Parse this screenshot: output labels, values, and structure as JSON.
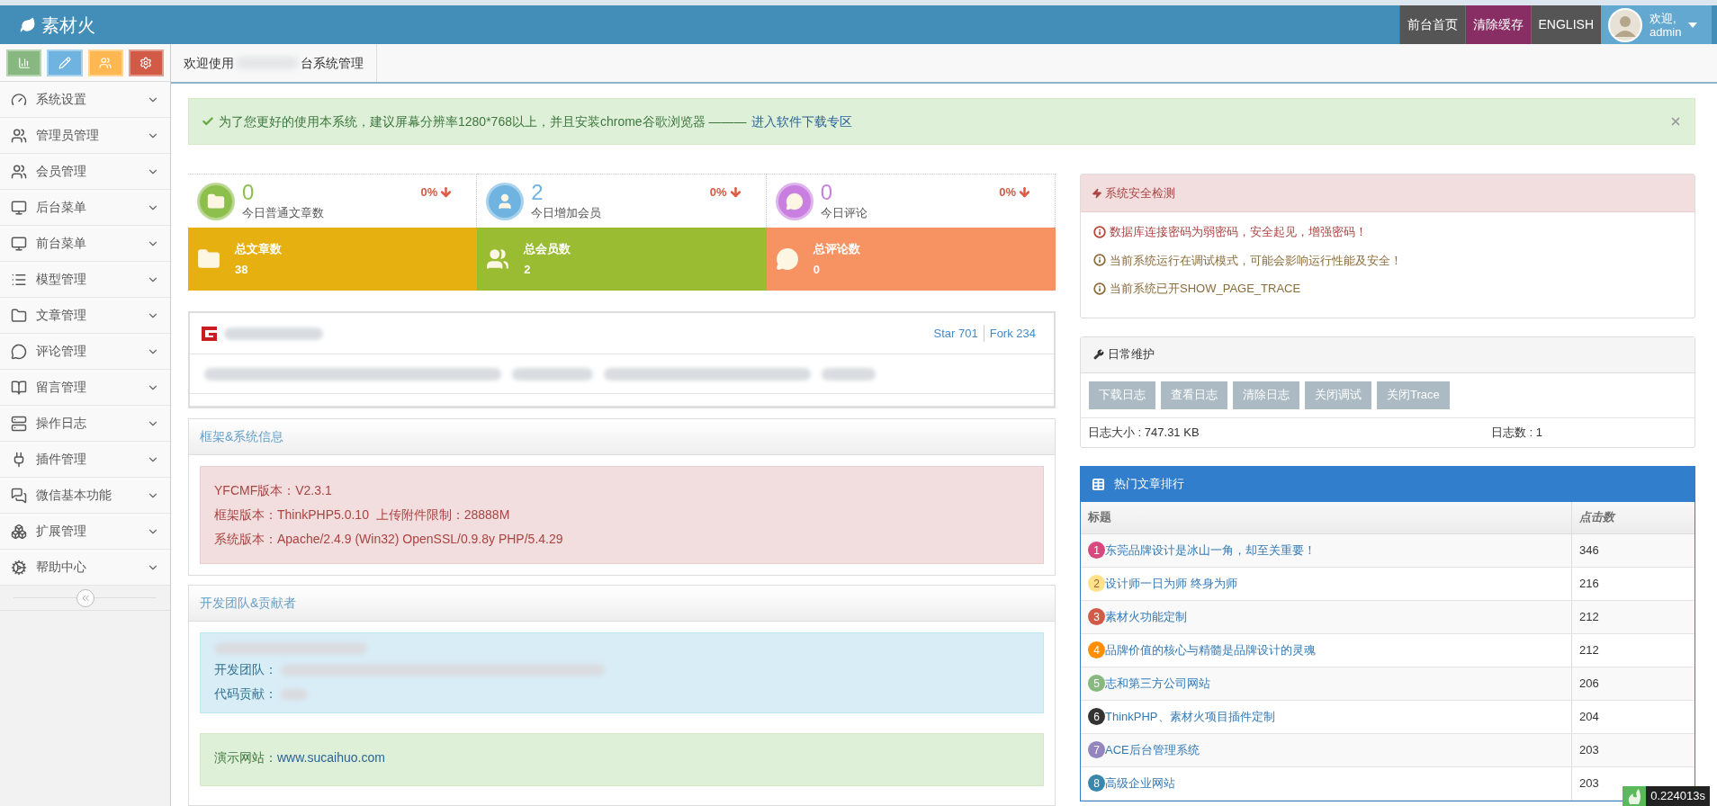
{
  "header": {
    "brand": "素材火",
    "nav_buttons": [
      {
        "label": "前台首页",
        "color": "#555555"
      },
      {
        "label": "清除缓存",
        "color": "#892e65"
      },
      {
        "label": "ENGLISH",
        "color": "#555555"
      }
    ],
    "user": {
      "greeting": "欢迎,",
      "name": "admin"
    }
  },
  "shortcuts": [
    {
      "kind": "chart",
      "color": "#87b87f"
    },
    {
      "kind": "pencil",
      "color": "#6fb3e0"
    },
    {
      "kind": "users",
      "color": "#ffb752"
    },
    {
      "kind": "cogs",
      "color": "#d15b47"
    }
  ],
  "sidebar": {
    "items": [
      {
        "label": "系统设置"
      },
      {
        "label": "管理员管理"
      },
      {
        "label": "会员管理"
      },
      {
        "label": "后台菜单"
      },
      {
        "label": "前台菜单"
      },
      {
        "label": "模型管理"
      },
      {
        "label": "文章管理"
      },
      {
        "label": "评论管理"
      },
      {
        "label": "留言管理"
      },
      {
        "label": "操作日志"
      },
      {
        "label": "插件管理"
      },
      {
        "label": "微信基本功能"
      },
      {
        "label": "扩展管理"
      },
      {
        "label": "帮助中心"
      }
    ]
  },
  "tabs": [
    {
      "label_parts": [
        "欢迎使用",
        "台系统管理"
      ],
      "selected": true
    }
  ],
  "alert": {
    "text": "为了您更好的使用本系统，建议屏幕分辨率1280*768以上，并且安装chrome谷歌浏览器 ———",
    "link": "进入软件下载专区"
  },
  "stats": [
    {
      "today": {
        "count": "0",
        "label": "今日普通文章数",
        "change": "0%",
        "color": "#8cbf4c"
      },
      "total": {
        "label": "总文章数",
        "value": "38",
        "color": "#e7b011"
      }
    },
    {
      "today": {
        "count": "2",
        "label": "今日增加会员",
        "change": "0%",
        "color": "#6fb3e0"
      },
      "total": {
        "label": "总会员数",
        "value": "2",
        "color": "#9abc32"
      }
    },
    {
      "today": {
        "count": "0",
        "label": "今日评论",
        "change": "0%",
        "color": "#c97fe0"
      },
      "total": {
        "label": "总评论数",
        "value": "0",
        "color": "#f79263"
      }
    }
  ],
  "git_panel": {
    "links": [
      "Star 701",
      "Fork 234"
    ]
  },
  "system_info": {
    "title": "框架&系统信息",
    "lines": [
      "YFCMF版本：V2.3.1",
      "框架版本：ThinkPHP5.0.10  上传附件限制：28888M",
      "系统版本：Apache/2.4.9 (Win32) OpenSSL/0.9.8y PHP/5.4.29"
    ]
  },
  "team": {
    "title": "开发团队&贡献者",
    "info_lines": [
      "开发团队：",
      "代码贡献："
    ],
    "demo": {
      "label": "演示网站：",
      "link": "www.sucaihuo.com"
    }
  },
  "security": {
    "title": "系统安全检测",
    "items": [
      {
        "kind": "danger",
        "text": "数据库连接密码为弱密码，安全起见，增强密码！"
      },
      {
        "kind": "warning",
        "text": "当前系统运行在调试模式，可能会影响运行性能及安全！"
      },
      {
        "kind": "warning",
        "text": "当前系统已开SHOW_PAGE_TRACE"
      }
    ]
  },
  "maintenance": {
    "title": "日常维护",
    "buttons": [
      "下载日志",
      "查看日志",
      "清除日志",
      "关闭调试",
      "关闭Trace"
    ],
    "log_size": "日志大小 : 747.31 KB",
    "log_count": "日志数 : 1"
  },
  "hot_articles": {
    "title": "热门文章排行",
    "columns": [
      "标题",
      "点击数"
    ],
    "rows": [
      {
        "rank": "1",
        "title": "东莞品牌设计是冰山一角，却至关重要！",
        "clicks": "346",
        "color": "#d6487e"
      },
      {
        "rank": "2",
        "title": "设计师一日为师 终身为师",
        "clicks": "216",
        "color": "#fee188"
      },
      {
        "rank": "3",
        "title": "素材火功能定制",
        "clicks": "212",
        "color": "#d15b47"
      },
      {
        "rank": "4",
        "title": "品牌价值的核心与精髓是品牌设计的灵魂",
        "clicks": "212",
        "color": "#ff8f00"
      },
      {
        "rank": "5",
        "title": "志和第三方公司网站",
        "clicks": "206",
        "color": "#87b87f"
      },
      {
        "rank": "6",
        "title": "ThinkPHP、素材火项目插件定制",
        "clicks": "204",
        "color": "#333333"
      },
      {
        "rank": "7",
        "title": "ACE后台管理系统",
        "clicks": "203",
        "color": "#9585bf"
      },
      {
        "rank": "8",
        "title": "高级企业网站",
        "clicks": "203",
        "color": "#3a87ad"
      }
    ]
  },
  "trace": {
    "time": "0.224013s"
  }
}
